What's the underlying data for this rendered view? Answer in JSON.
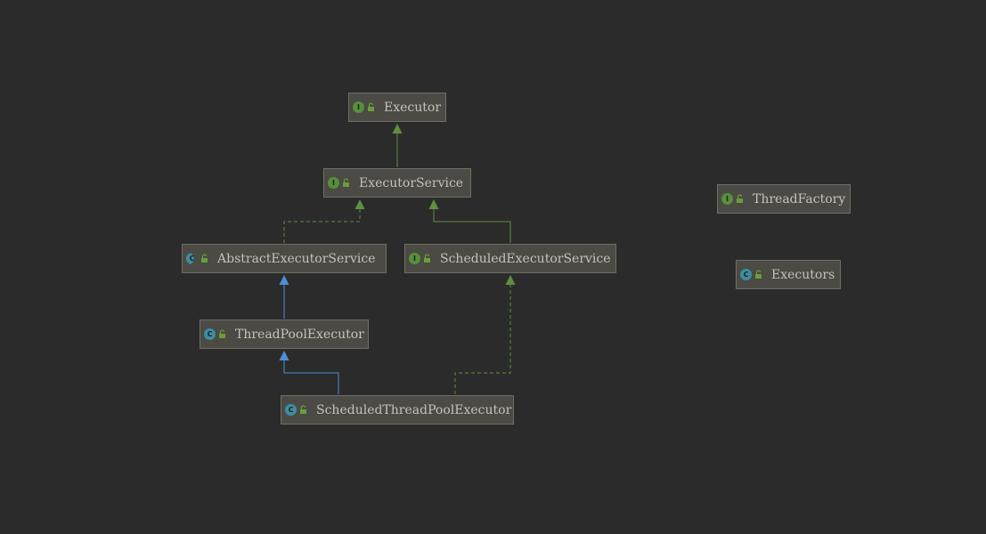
{
  "diagram": {
    "colors": {
      "background": "#2b2b2b",
      "node_fill": "#4b4a44",
      "node_border": "#6f6e66",
      "node_text": "#c3c3b8",
      "interface_edge": "#5f8f3f",
      "class_edge": "#4f8fd6",
      "interface_badge": "#56903a",
      "class_badge": "#3d8ea3"
    },
    "nodes": [
      {
        "id": "executor",
        "label": "Executor",
        "kind": "interface",
        "badge": "I"
      },
      {
        "id": "executor-service",
        "label": "ExecutorService",
        "kind": "interface",
        "badge": "I"
      },
      {
        "id": "abstract-executor-service",
        "label": "AbstractExecutorService",
        "kind": "abstract",
        "badge": "C"
      },
      {
        "id": "scheduled-executor-service",
        "label": "ScheduledExecutorService",
        "kind": "interface",
        "badge": "I"
      },
      {
        "id": "thread-pool-executor",
        "label": "ThreadPoolExecutor",
        "kind": "class",
        "badge": "C"
      },
      {
        "id": "scheduled-thread-pool-executor",
        "label": "ScheduledThreadPoolExecutor",
        "kind": "class",
        "badge": "C"
      },
      {
        "id": "thread-factory",
        "label": "ThreadFactory",
        "kind": "interface",
        "badge": "I"
      },
      {
        "id": "executors",
        "label": "Executors",
        "kind": "class",
        "badge": "C"
      }
    ],
    "edges": [
      {
        "from": "executor-service",
        "to": "executor",
        "relation": "extends-interface"
      },
      {
        "from": "abstract-executor-service",
        "to": "executor-service",
        "relation": "implements"
      },
      {
        "from": "scheduled-executor-service",
        "to": "executor-service",
        "relation": "extends-interface"
      },
      {
        "from": "thread-pool-executor",
        "to": "abstract-executor-service",
        "relation": "extends-class"
      },
      {
        "from": "scheduled-thread-pool-executor",
        "to": "thread-pool-executor",
        "relation": "extends-class"
      },
      {
        "from": "scheduled-thread-pool-executor",
        "to": "scheduled-executor-service",
        "relation": "implements"
      }
    ]
  }
}
